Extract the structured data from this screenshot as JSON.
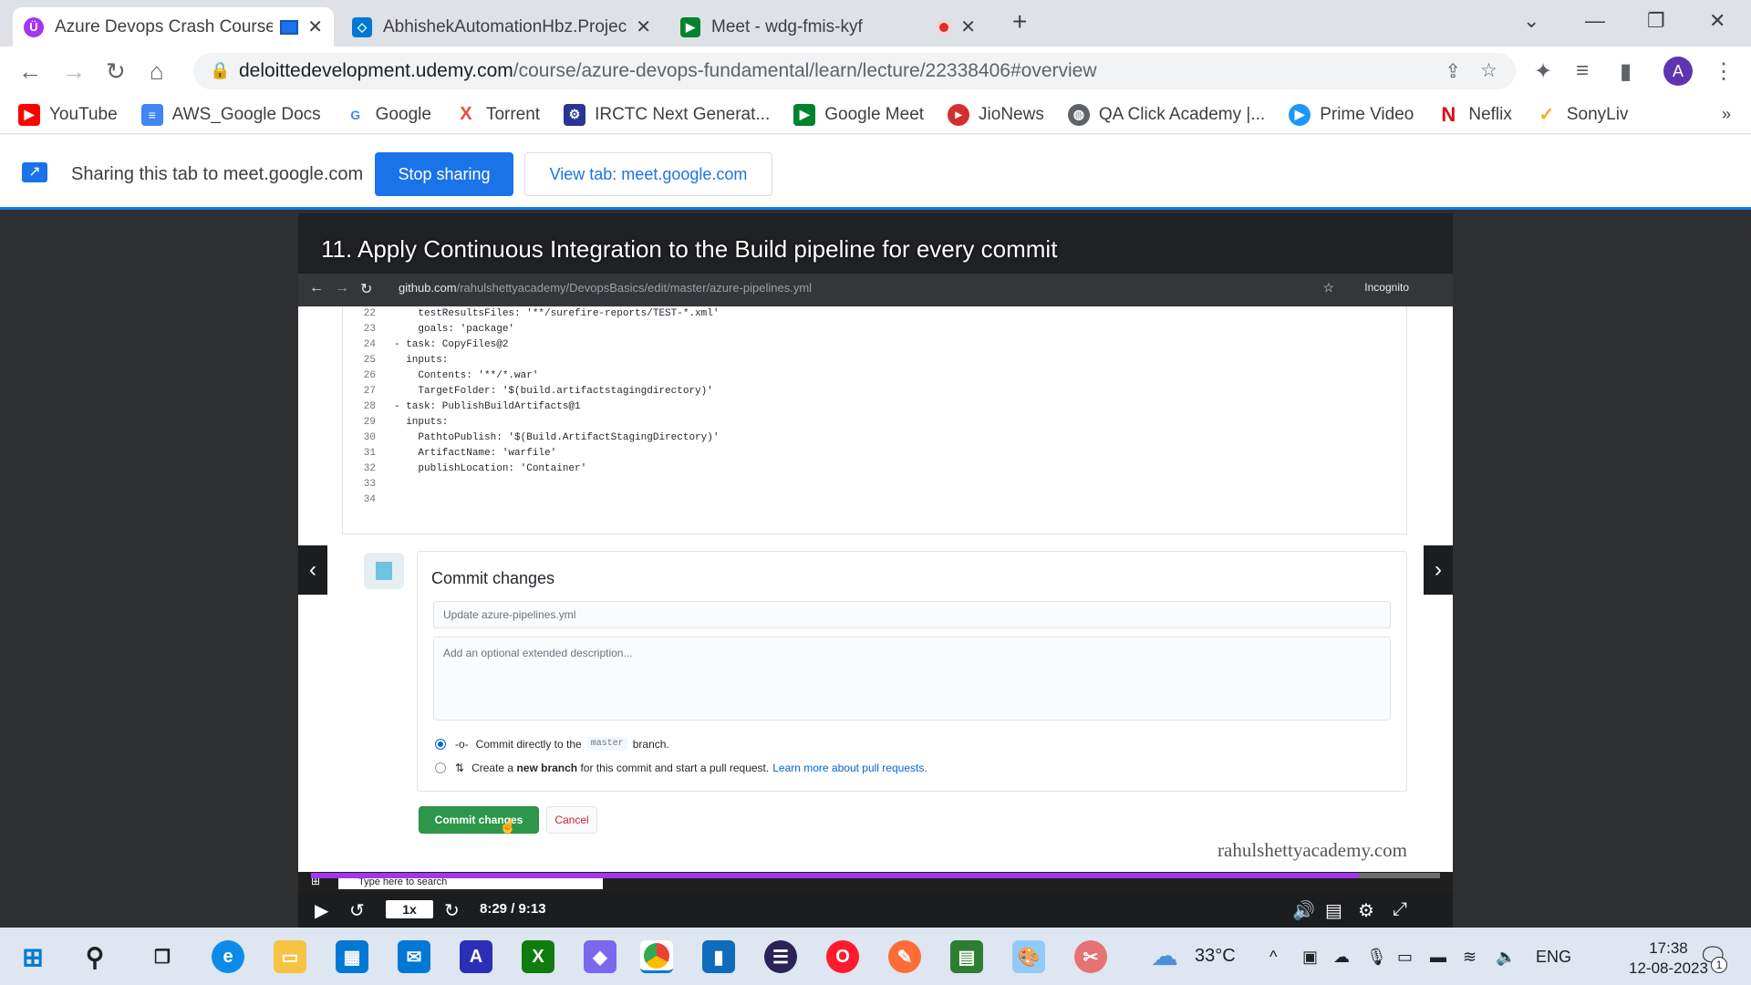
{
  "browser": {
    "tabs": [
      {
        "title": "Azure Devops Crash Course",
        "active": true,
        "color": "#a435f0"
      },
      {
        "title": "AbhishekAutomationHbz.Project",
        "active": false,
        "color": "#0078d4"
      },
      {
        "title": "Meet - wdg-fmis-kyf",
        "active": false,
        "color": "#00832d"
      }
    ],
    "url_host": "deloittedevelopment.udemy.com",
    "url_path": "/course/azure-devops-fundamental/learn/lecture/22338406#overview",
    "profile_initial": "A",
    "bookmarks": [
      {
        "label": "YouTube",
        "icon": "youtube-icon",
        "color": "#ff0000"
      },
      {
        "label": "AWS_Google Docs",
        "icon": "docs-icon",
        "color": "#4285f4"
      },
      {
        "label": "Google",
        "icon": "google-icon",
        "color": "#4285f4"
      },
      {
        "label": "Torrent",
        "icon": "torrent-icon",
        "color": "#e74c3c"
      },
      {
        "label": "IRCTC Next Generat...",
        "icon": "irctc-icon",
        "color": "#283593"
      },
      {
        "label": "Google Meet",
        "icon": "meet-icon",
        "color": "#00832d"
      },
      {
        "label": "JioNews",
        "icon": "jionews-icon",
        "color": "#d32f2f"
      },
      {
        "label": "QA Click Academy |...",
        "icon": "globe-icon",
        "color": "#5f6368"
      },
      {
        "label": "Prime Video",
        "icon": "prime-icon",
        "color": "#1a98ff"
      },
      {
        "label": "Neflix",
        "icon": "netflix-icon",
        "color": "#e50914"
      },
      {
        "label": "SonyLiv",
        "icon": "sonyliv-icon",
        "color": "#f9a825"
      }
    ]
  },
  "sharing": {
    "text": "Sharing this tab to meet.google.com",
    "stop_label": "Stop sharing",
    "view_label": "View tab: meet.google.com"
  },
  "video": {
    "lecture_title": "11. Apply Continuous Integration to the Build pipeline for every commit",
    "inner_url_host": "github.com",
    "inner_url_path": "/rahulshettyacademy/DevopsBasics/edit/master/azure-pipelines.yml",
    "incognito_label": "Incognito",
    "code_lines": [
      {
        "n": "22",
        "text": "    testResultsFiles: '**/surefire-reports/TEST-*.xml'"
      },
      {
        "n": "23",
        "text": "    goals: 'package'"
      },
      {
        "n": "24",
        "text": "- task: CopyFiles@2"
      },
      {
        "n": "25",
        "text": "  inputs:"
      },
      {
        "n": "26",
        "text": "    Contents: '**/*.war'"
      },
      {
        "n": "27",
        "text": "    TargetFolder: '$(build.artifactstagingdirectory)'"
      },
      {
        "n": "28",
        "text": "- task: PublishBuildArtifacts@1"
      },
      {
        "n": "29",
        "text": "  inputs:"
      },
      {
        "n": "30",
        "text": "    PathtoPublish: '$(Build.ArtifactStagingDirectory)'"
      },
      {
        "n": "31",
        "text": "    ArtifactName: 'warfile'"
      },
      {
        "n": "32",
        "text": "    publishLocation: 'Container'"
      },
      {
        "n": "33",
        "text": ""
      },
      {
        "n": "34",
        "text": ""
      }
    ],
    "commit_heading": "Commit changes",
    "summary_placeholder": "Update azure-pipelines.yml",
    "desc_placeholder": "Add an optional extended description...",
    "option_direct_pre": "Commit directly to the",
    "option_direct_branch": "master",
    "option_direct_post": "branch.",
    "option_new_pre": "Create a",
    "option_new_bold": "new branch",
    "option_new_post": "for this commit and start a pull request.",
    "option_new_link": "Learn more about pull requests.",
    "commit_button": "Commit changes",
    "cancel_button": "Cancel",
    "watermark": "rahulshettyacademy.com",
    "inner_search": "Type here to search",
    "speed": "1x",
    "timecode": "8:29 / 9:13",
    "progress": 0.928
  },
  "taskbar": {
    "weather": "33°C",
    "lang": "ENG",
    "time": "17:38",
    "date": "12-08-2023",
    "notifications": "1"
  }
}
